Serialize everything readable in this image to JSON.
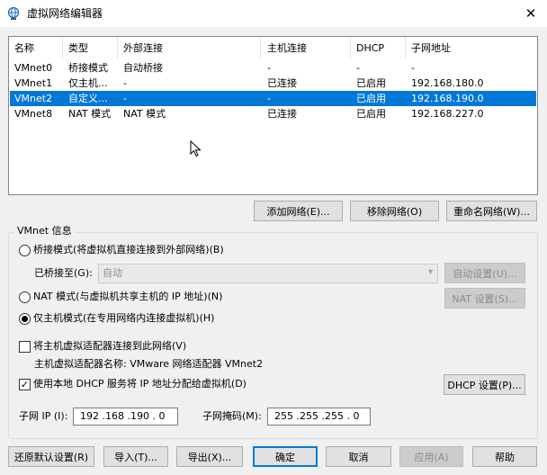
{
  "window": {
    "title": "虚拟网络编辑器",
    "close_glyph": "✕"
  },
  "table": {
    "columns": [
      "名称",
      "类型",
      "外部连接",
      "主机连接",
      "DHCP",
      "子网地址"
    ],
    "rows": [
      {
        "name": "VMnet0",
        "type": "桥接模式",
        "external": "自动桥接",
        "host": "-",
        "dhcp": "-",
        "subnet": "-",
        "selected": false
      },
      {
        "name": "VMnet1",
        "type": "仅主机...",
        "external": "-",
        "host": "已连接",
        "dhcp": "已启用",
        "subnet": "192.168.180.0",
        "selected": false
      },
      {
        "name": "VMnet2",
        "type": "自定义...",
        "external": "-",
        "host": "-",
        "dhcp": "已启用",
        "subnet": "192.168.190.0",
        "selected": true
      },
      {
        "name": "VMnet8",
        "type": "NAT 模式",
        "external": "NAT 模式",
        "host": "已连接",
        "dhcp": "已启用",
        "subnet": "192.168.227.0",
        "selected": false
      }
    ]
  },
  "list_buttons": {
    "add": "添加网络(E)...",
    "remove": "移除网络(O)",
    "rename": "重命名网络(W)..."
  },
  "vmnet_info": {
    "title": "VMnet 信息",
    "bridged_label": "桥接模式(将虚拟机直接连接到外部网络)(B)",
    "bridged_to_label": "已桥接至(G):",
    "bridged_to_value": "自动",
    "auto_settings": "自动设置(U)...",
    "nat_label": "NAT 模式(与虚拟机共享主机的 IP 地址)(N)",
    "nat_settings": "NAT 设置(S)...",
    "hostonly_label": "仅主机模式(在专用网络内连接虚拟机)(H)",
    "selected_mode": "hostonly",
    "connect_adapter_label": "将主机虚拟适配器连接到此网络(V)",
    "connect_adapter_checked": false,
    "adapter_name_label": "主机虚拟适配器名称: VMware 网络适配器 VMnet2",
    "dhcp_label": "使用本地 DHCP 服务将 IP 地址分配给虚拟机(D)",
    "dhcp_checked": true,
    "dhcp_settings": "DHCP 设置(P)...",
    "subnet_ip_label": "子网 IP (I):",
    "subnet_ip": "192 .168 .190 . 0",
    "subnet_mask_label": "子网掩码(M):",
    "subnet_mask": "255 .255 .255 . 0"
  },
  "footer": {
    "restore": "还原默认设置(R)",
    "import": "导入(T)...",
    "export": "导出(X)...",
    "ok": "确定",
    "cancel": "取消",
    "apply": "应用(A)",
    "help": "帮助"
  }
}
